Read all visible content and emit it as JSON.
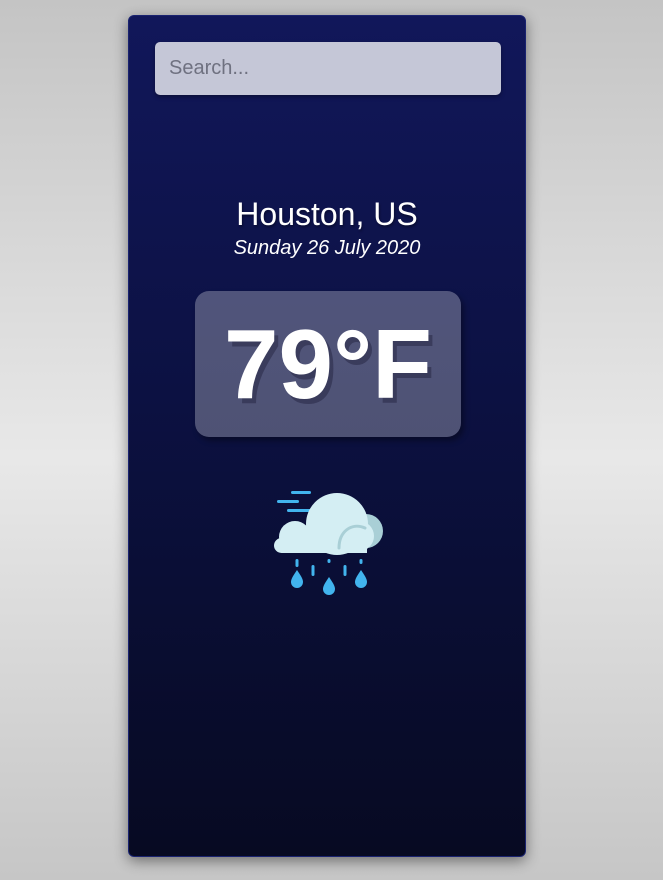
{
  "search": {
    "placeholder": "Search...",
    "value": ""
  },
  "location": {
    "city_country": "Houston, US",
    "date": "Sunday 26 July 2020"
  },
  "weather": {
    "temperature": "79°F",
    "condition_icon": "rain-cloud-icon"
  },
  "colors": {
    "card_top": "#11175a",
    "card_bottom": "#070a22",
    "search_bg": "#c5c7d7",
    "cloud": "#d4eef3",
    "cloud_shade": "#a9cfd6",
    "rain": "#42b4ee"
  }
}
